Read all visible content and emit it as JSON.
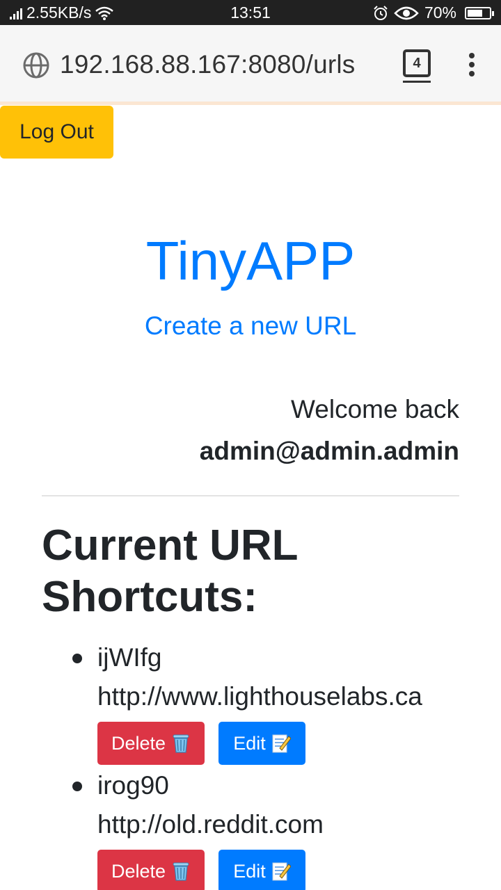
{
  "status_bar": {
    "speed": "2.55KB/s",
    "time": "13:51",
    "battery": "70%",
    "battery_level": 0.7,
    "icons": [
      "signal-icon",
      "wifi-icon",
      "alarm-icon",
      "eye-icon",
      "battery-icon"
    ]
  },
  "browser": {
    "url": "192.168.88.167:8080/urls",
    "tab_count": "4"
  },
  "page": {
    "logout_label": "Log Out",
    "title": "TinyAPP",
    "create_link": "Create a new URL",
    "welcome": "Welcome back",
    "user_email": "admin@admin.admin",
    "heading": "Current URL Shortcuts:"
  },
  "urls": [
    {
      "short": "ijWIfg",
      "long": "http://www.lighthouselabs.ca",
      "delete_label": "Delete",
      "edit_label": "Edit"
    },
    {
      "short": "irog90",
      "long": "http://old.reddit.com",
      "delete_label": "Delete",
      "edit_label": "Edit"
    }
  ],
  "colors": {
    "primary": "#007bff",
    "warning": "#ffc107",
    "danger": "#dc3545",
    "text": "#212529"
  }
}
